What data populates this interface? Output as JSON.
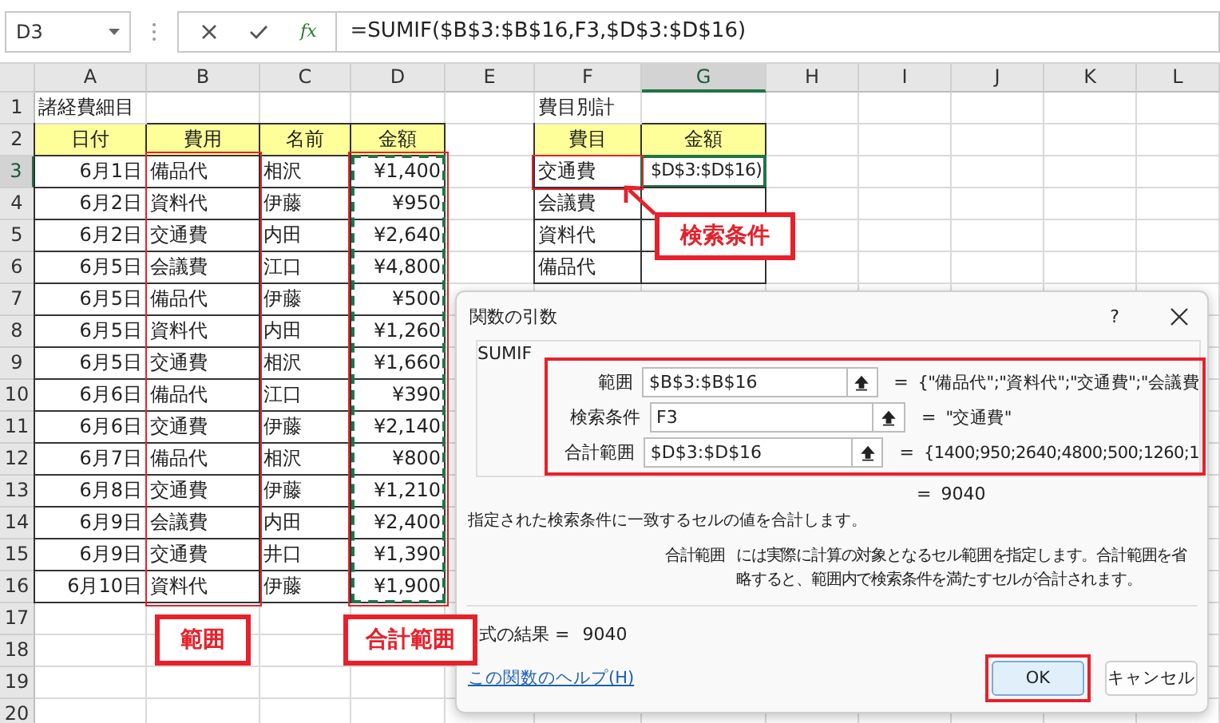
{
  "formula_bar": {
    "name_box": "D3",
    "function_button": "fx",
    "formula": "=SUMIF($B$3:$B$16,F3,$D$3:$D$16)"
  },
  "sheet": {
    "columns": [
      {
        "label": "A",
        "selected": false
      },
      {
        "label": "B",
        "selected": false
      },
      {
        "label": "C",
        "selected": false
      },
      {
        "label": "D",
        "selected": false
      },
      {
        "label": "E",
        "selected": false
      },
      {
        "label": "F",
        "selected": false
      },
      {
        "label": "G",
        "selected": true
      },
      {
        "label": "H",
        "selected": false
      },
      {
        "label": "I",
        "selected": false
      },
      {
        "label": "J",
        "selected": false
      },
      {
        "label": "K",
        "selected": false
      },
      {
        "label": "L",
        "selected": false
      }
    ],
    "row_numbers": [
      {
        "label": "1",
        "selected": false
      },
      {
        "label": "2",
        "selected": false
      },
      {
        "label": "3",
        "selected": true
      },
      {
        "label": "4",
        "selected": false
      },
      {
        "label": "5",
        "selected": false
      },
      {
        "label": "6",
        "selected": false
      },
      {
        "label": "7",
        "selected": false
      },
      {
        "label": "8",
        "selected": false
      },
      {
        "label": "9",
        "selected": false
      },
      {
        "label": "10",
        "selected": false
      },
      {
        "label": "11",
        "selected": false
      },
      {
        "label": "12",
        "selected": false
      },
      {
        "label": "13",
        "selected": false
      },
      {
        "label": "14",
        "selected": false
      },
      {
        "label": "15",
        "selected": false
      },
      {
        "label": "16",
        "selected": false
      },
      {
        "label": "17",
        "selected": false
      },
      {
        "label": "18",
        "selected": false
      },
      {
        "label": "19",
        "selected": false
      },
      {
        "label": "20",
        "selected": false
      }
    ]
  },
  "expense_table": {
    "title": "諸経費細目",
    "columns": [
      "日付",
      "費用",
      "名前",
      "金額"
    ],
    "rows": [
      {
        "date": "6月1日",
        "category": "備品代",
        "name": "相沢",
        "amount": "¥1,400"
      },
      {
        "date": "6月2日",
        "category": "資料代",
        "name": "伊藤",
        "amount": "¥950"
      },
      {
        "date": "6月2日",
        "category": "交通費",
        "name": "内田",
        "amount": "¥2,640"
      },
      {
        "date": "6月5日",
        "category": "会議費",
        "name": "江口",
        "amount": "¥4,800"
      },
      {
        "date": "6月5日",
        "category": "備品代",
        "name": "伊藤",
        "amount": "¥500"
      },
      {
        "date": "6月5日",
        "category": "資料代",
        "name": "内田",
        "amount": "¥1,260"
      },
      {
        "date": "6月5日",
        "category": "交通費",
        "name": "相沢",
        "amount": "¥1,660"
      },
      {
        "date": "6月6日",
        "category": "備品代",
        "name": "江口",
        "amount": "¥390"
      },
      {
        "date": "6月6日",
        "category": "交通費",
        "name": "伊藤",
        "amount": "¥2,140"
      },
      {
        "date": "6月7日",
        "category": "備品代",
        "name": "相沢",
        "amount": "¥800"
      },
      {
        "date": "6月8日",
        "category": "交通費",
        "name": "伊藤",
        "amount": "¥1,210"
      },
      {
        "date": "6月9日",
        "category": "会議費",
        "name": "内田",
        "amount": "¥2,400"
      },
      {
        "date": "6月9日",
        "category": "交通費",
        "name": "井口",
        "amount": "¥1,390"
      },
      {
        "date": "6月10日",
        "category": "資料代",
        "name": "伊藤",
        "amount": "¥1,900"
      }
    ],
    "amount_marquee": true,
    "range_callout": "範囲",
    "sum_range_callout": "合計範囲"
  },
  "summary_table": {
    "title": "費目別計",
    "columns": [
      "費目",
      "金額"
    ],
    "rows": [
      {
        "category": "交通費",
        "amount": "$D$3:$D$16)",
        "active": true
      },
      {
        "category": "会議費",
        "active": false
      },
      {
        "category": "資料代",
        "active": false
      },
      {
        "category": "備品代",
        "active": false
      }
    ],
    "criteria_callout": "検索条件"
  },
  "dialog": {
    "title": "関数の引数",
    "help": "?",
    "function_name": "SUMIF",
    "arguments_highlighted": true,
    "arguments": [
      {
        "label": "範囲",
        "value": "$B$3:$B$16",
        "result": "{\"備品代\";\"資料代\";\"交通費\";\"会議費"
      },
      {
        "label": "検索条件",
        "value": "F3",
        "result": "\"交通費\""
      },
      {
        "label": "合計範囲",
        "value": "$D$3:$D$16",
        "result": "{1400;950;2640;4800;500;1260;1"
      }
    ],
    "equals": "=",
    "function_result": "9040",
    "description": "指定された検索条件に一致するセルの値を合計します。",
    "argument_help": {
      "name": "合計範囲",
      "text": "には実際に計算の対象となるセル範囲を指定します。合計範囲を省略すると、範囲内で検索条件を満たすセルが合計されます。"
    },
    "formula_result_label": "式の結果 =",
    "formula_result": "9040",
    "help_link": "この関数のヘルプ(H)",
    "buttons": [
      {
        "label": "OK",
        "default": true,
        "highlighted": true
      },
      {
        "label": "キャンセル",
        "default": false,
        "highlighted": false
      }
    ]
  }
}
